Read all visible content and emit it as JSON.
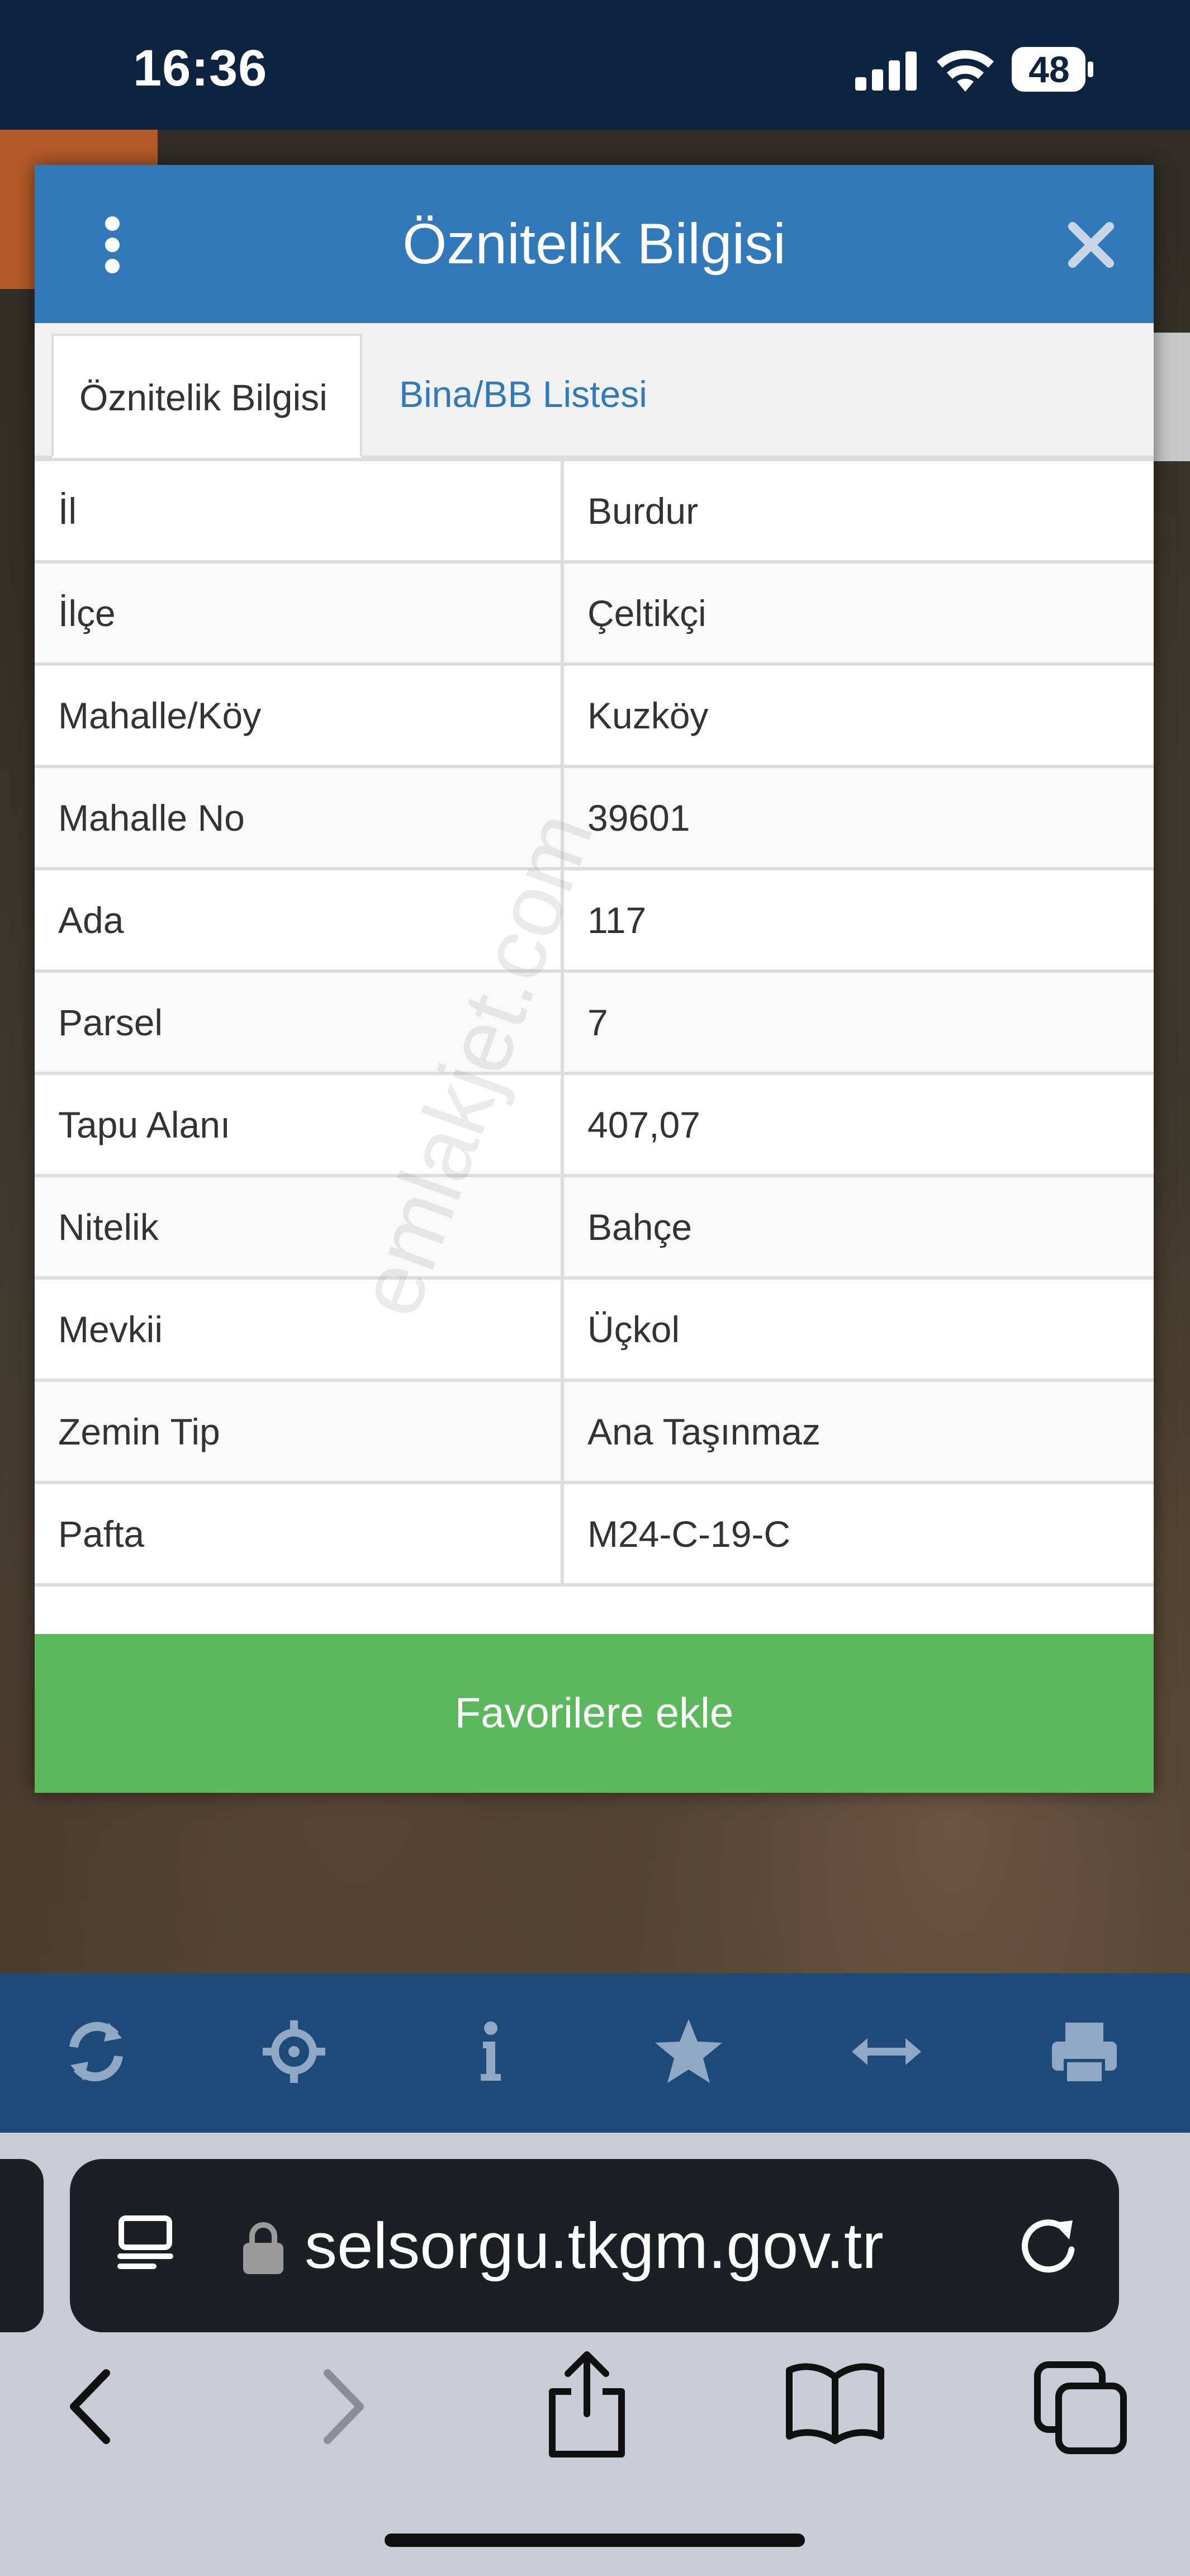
{
  "status_bar": {
    "time": "16:36",
    "battery": "48"
  },
  "modal": {
    "title": "Öznitelik Bilgisi",
    "tabs": [
      {
        "label": "Öznitelik Bilgisi",
        "active": true
      },
      {
        "label": "Bina/BB Listesi",
        "active": false
      }
    ],
    "rows": [
      {
        "key": "İl",
        "value": "Burdur"
      },
      {
        "key": "İlçe",
        "value": "Çeltikçi"
      },
      {
        "key": "Mahalle/Köy",
        "value": "Kuzköy"
      },
      {
        "key": "Mahalle No",
        "value": "39601"
      },
      {
        "key": "Ada",
        "value": "117"
      },
      {
        "key": "Parsel",
        "value": "7"
      },
      {
        "key": "Tapu Alanı",
        "value": "407,07"
      },
      {
        "key": "Nitelik",
        "value": "Bahçe"
      },
      {
        "key": "Mevkii",
        "value": "Üçkol"
      },
      {
        "key": "Zemin Tip",
        "value": "Ana Taşınmaz"
      },
      {
        "key": "Pafta",
        "value": "M24-C-19-C"
      }
    ],
    "favorite_label": "Favorilere ekle",
    "watermark": "emlakjet.com"
  },
  "toolbar": {
    "icons": [
      "refresh-icon",
      "locate-icon",
      "info-icon",
      "star-icon",
      "measure-icon",
      "print-icon"
    ]
  },
  "browser": {
    "url": "selsorgu.tkgm.gov.tr",
    "nav_icons": [
      "back-icon",
      "forward-icon",
      "share-icon",
      "bookmarks-icon",
      "tabs-icon"
    ]
  },
  "colors": {
    "header_blue": "#3279ba",
    "favorite_green": "#5cb85c",
    "toolbar_blue": "#1e4a7a",
    "status_bar": "#0c2440"
  }
}
